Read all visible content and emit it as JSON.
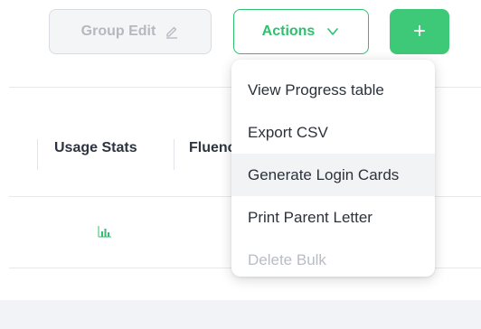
{
  "toolbar": {
    "group_edit_label": "Group Edit",
    "actions_label": "Actions",
    "add_label": "+"
  },
  "table": {
    "columns": [
      "Usage Stats",
      "Fluency"
    ]
  },
  "actions_menu": {
    "items": [
      {
        "label": "View Progress table",
        "state": "normal"
      },
      {
        "label": "Export CSV",
        "state": "normal"
      },
      {
        "label": "Generate Login Cards",
        "state": "hover"
      },
      {
        "label": "Print Parent Letter",
        "state": "normal"
      },
      {
        "label": "Delete Bulk",
        "state": "disabled"
      }
    ]
  },
  "icons": {
    "group_edit": "pencil-icon",
    "actions_caret": "chevron-down-icon",
    "usage_stats": "bar-chart-icon"
  },
  "colors": {
    "accent_green": "#2fbf6f",
    "add_button_green": "#3ec978",
    "disabled_text": "#b4b8bf",
    "menu_hover_bg": "#f2f3f5"
  }
}
